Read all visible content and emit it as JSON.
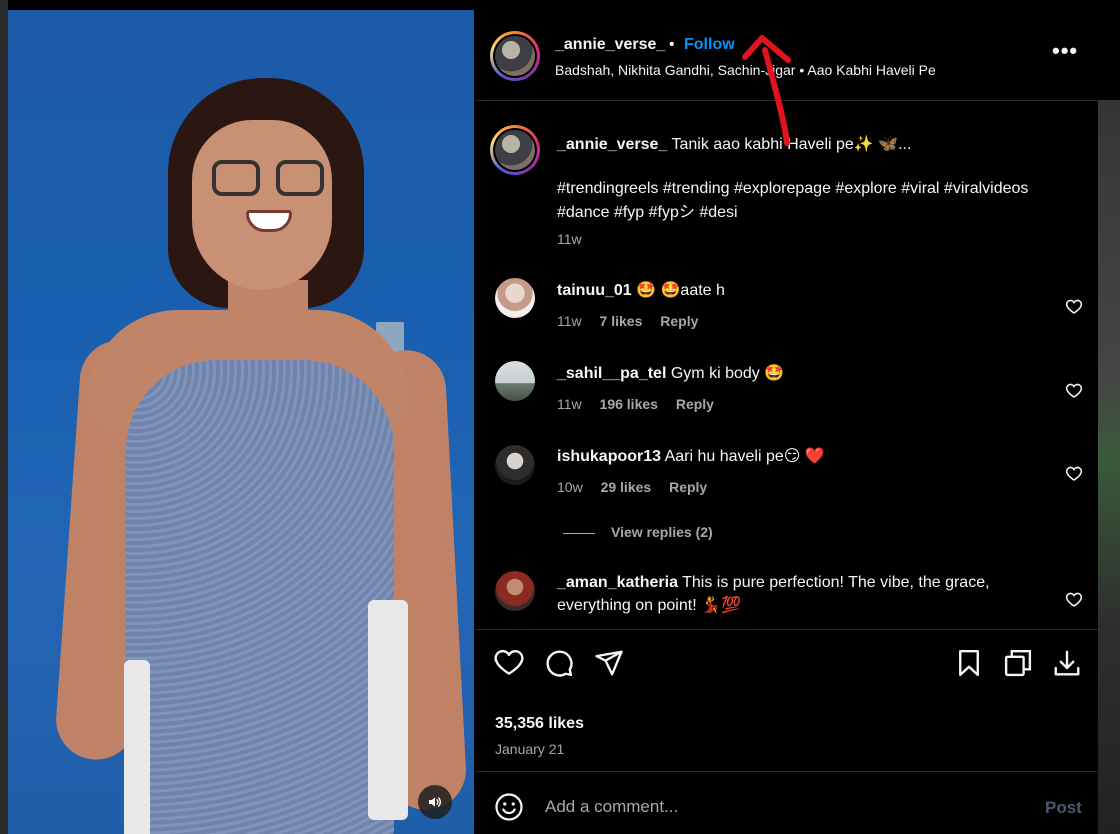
{
  "post": {
    "username": "_annie_verse_",
    "separator": "•",
    "follow_label": "Follow",
    "audio": "Badshah, Nikhita Gandhi, Sachin-Jigar • Aao Kabhi Haveli Pe",
    "more_label": "•••"
  },
  "caption": {
    "username": "_annie_verse_",
    "text": "Tanik aao kabhi Haveli pe✨ 🦋...",
    "hashtags": "#trendingreels #trending #explorepage #explore #viral #viralvideos #dance #fyp #fypシ #desi",
    "time": "11w"
  },
  "comments": [
    {
      "username": "tainuu_01",
      "text": "🤩 🤩aate h",
      "time": "11w",
      "likes": "7 likes",
      "reply": "Reply"
    },
    {
      "username": "_sahil__pa_tel",
      "text": "Gym ki body 🤩",
      "time": "11w",
      "likes": "196 likes",
      "reply": "Reply"
    },
    {
      "username": "ishukapoor13",
      "text": "Aari hu haveli pe😏 ❤️",
      "time": "10w",
      "likes": "29 likes",
      "reply": "Reply"
    },
    {
      "username": "_aman_katheria",
      "text": "This is pure perfection! The vibe, the grace, everything on point! 💃💯"
    }
  ],
  "view_replies": "View replies (2)",
  "stats": {
    "likes": "35,356 likes",
    "date": "January 21"
  },
  "composer": {
    "placeholder": "Add a comment...",
    "post_label": "Post"
  },
  "colors": {
    "accent": "#0095f6",
    "annotation_arrow": "#e0141e"
  },
  "icons": {
    "mute": "speaker-icon",
    "like": "heart-icon",
    "comment": "comment-bubble-icon",
    "share": "paper-plane-icon",
    "save": "bookmark-icon",
    "collection": "copy-icon",
    "download": "download-icon",
    "emoji": "smiley-icon"
  }
}
